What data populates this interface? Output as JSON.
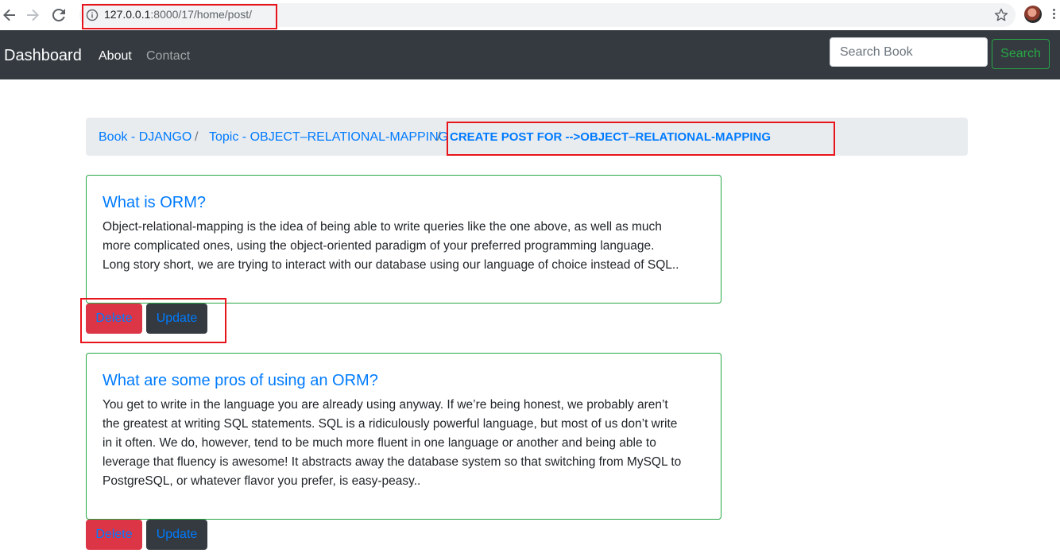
{
  "browser": {
    "url_host": "127.0.0.1",
    "url_path": ":8000/17/home/post/"
  },
  "navbar": {
    "brand": "Dashboard",
    "links": [
      {
        "label": "About"
      },
      {
        "label": "Contact"
      }
    ],
    "search_placeholder": "Search Book",
    "search_button": "Search"
  },
  "breadcrumb": {
    "items": [
      {
        "label": "Book - DJANGO"
      },
      {
        "label": "Topic - OBJECT–RELATIONAL-MAPPING"
      }
    ],
    "separator": "/",
    "active": "CREATE POST FOR -->OBJECT–RELATIONAL-MAPPING"
  },
  "posts": [
    {
      "title": "What is ORM?",
      "lines": [
        "Object-relational-mapping is the idea of being able to write queries like the one above, as well as much",
        "more complicated ones, using the object-oriented paradigm of your preferred programming language.",
        "Long story short, we are trying to interact with our database using our language of choice instead of SQL.."
      ],
      "delete_label": "Delete",
      "update_label": "Update"
    },
    {
      "title": "What are some pros of using an ORM?",
      "lines": [
        "You get to write in the language you are already using anyway. If we’re being honest, we probably aren’t",
        "the greatest at writing SQL statements. SQL is a ridiculously powerful language, but most of us don’t write",
        "in it often. We do, however, tend to be much more fluent in one language or another and being able to",
        "leverage that fluency is awesome! It abstracts away the database system so that switching from MySQL to",
        "PostgreSQL, or whatever flavor you prefer, is easy-peasy.."
      ],
      "delete_label": "Delete",
      "update_label": "Update"
    }
  ],
  "colors": {
    "navbar_bg": "#343a40",
    "link": "#007bff",
    "success": "#28a745",
    "danger": "#dc3545",
    "annotation": "#e8141b"
  }
}
